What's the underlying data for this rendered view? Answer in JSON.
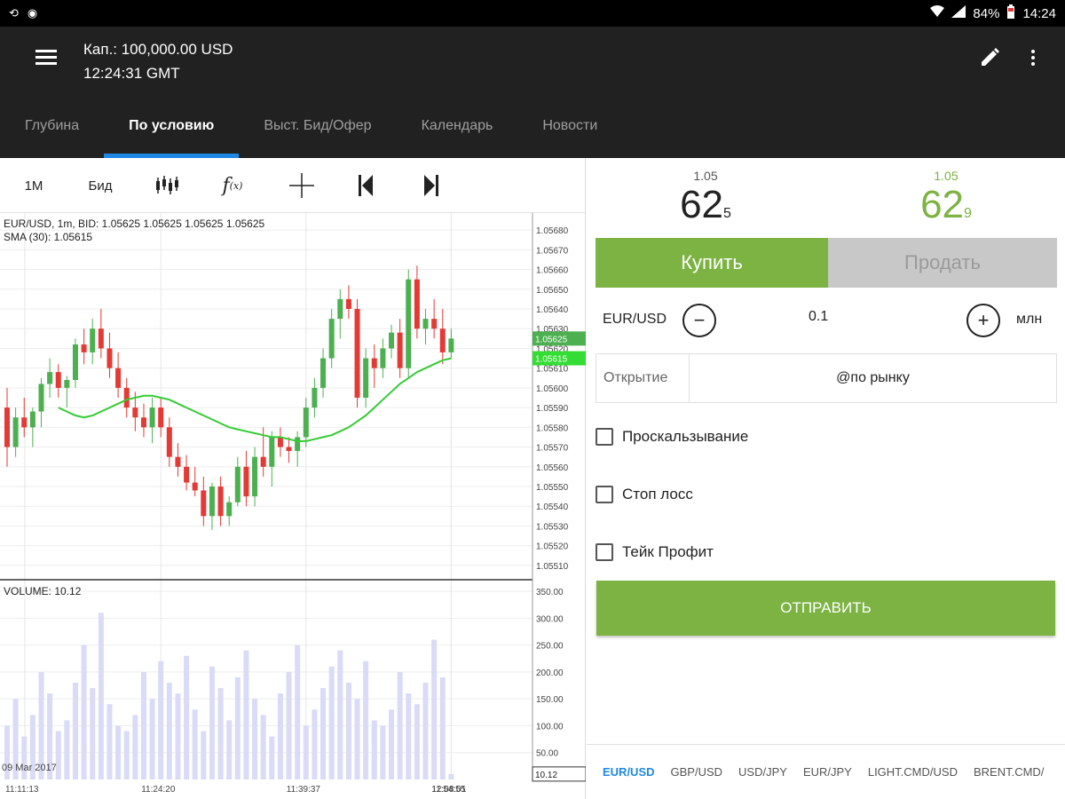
{
  "status_bar": {
    "left_icons": [
      "sync-icon",
      "notification-icon"
    ],
    "battery": "84%",
    "time": "14:24"
  },
  "header": {
    "capital": "Кап.: 100,000.00 USD",
    "time": "12:24:31 GMT"
  },
  "tabs": [
    {
      "label": "Глубина",
      "active": false
    },
    {
      "label": "По условию",
      "active": true
    },
    {
      "label": "Выст. Бид/Офер",
      "active": false
    },
    {
      "label": "Календарь",
      "active": false
    },
    {
      "label": "Новости",
      "active": false
    }
  ],
  "chart_toolbar": {
    "timeframe": "1M",
    "price_type": "Бид",
    "icons": [
      "candlestick-icon",
      "function-icon",
      "crosshair-icon",
      "jump-start-icon",
      "jump-end-icon"
    ]
  },
  "chart_info": {
    "line1": "EUR/USD, 1m, BID: 1.05625 1.05625 1.05625 1.05625",
    "line2": "SMA (30): 1.05615",
    "volume_label": "VOLUME: 10.12",
    "date_label": "09 Mar 2017"
  },
  "chart_data": {
    "type": "candlestick",
    "symbol": "EUR/USD",
    "timeframe": "1m",
    "price_ylim": [
      1.05505,
      1.05685
    ],
    "price_ticks": [
      "1.05680",
      "1.05670",
      "1.05660",
      "1.05650",
      "1.05640",
      "1.05630",
      "1.05620",
      "1.05610",
      "1.05600",
      "1.05590",
      "1.05580",
      "1.05570",
      "1.05560",
      "1.05550",
      "1.05540",
      "1.05530",
      "1.05520",
      "1.05510"
    ],
    "bid_marker": "1.05625",
    "sma_marker": "1.05615",
    "volume_ylim": [
      0,
      360
    ],
    "volume_ticks": [
      "350.00",
      "300.00",
      "250.00",
      "200.00",
      "150.00",
      "100.00",
      "50.00"
    ],
    "volume_current": "10.12",
    "time_labels": [
      "11:11:13",
      "11:24:20",
      "11:39:37",
      "11:54:55",
      "12:08:01"
    ],
    "time_label_index": [
      0,
      18,
      35,
      53,
      71
    ],
    "candles": [
      [
        1.0559,
        1.056,
        1.0556,
        1.0557
      ],
      [
        1.0557,
        1.0559,
        1.05565,
        1.05585
      ],
      [
        1.05585,
        1.05595,
        1.05575,
        1.0558
      ],
      [
        1.0558,
        1.0559,
        1.0557,
        1.05588
      ],
      [
        1.05588,
        1.05605,
        1.0558,
        1.05602
      ],
      [
        1.05602,
        1.05615,
        1.05595,
        1.05608
      ],
      [
        1.05608,
        1.05612,
        1.05595,
        1.056
      ],
      [
        1.056,
        1.05606,
        1.0559,
        1.05604
      ],
      [
        1.05604,
        1.05625,
        1.056,
        1.05622
      ],
      [
        1.05622,
        1.0563,
        1.05612,
        1.05618
      ],
      [
        1.05618,
        1.05635,
        1.05612,
        1.0563
      ],
      [
        1.0563,
        1.0564,
        1.05615,
        1.0562
      ],
      [
        1.0562,
        1.05628,
        1.05605,
        1.0561
      ],
      [
        1.0561,
        1.05618,
        1.05595,
        1.056
      ],
      [
        1.056,
        1.05605,
        1.05585,
        1.0559
      ],
      [
        1.0559,
        1.05598,
        1.05578,
        1.05585
      ],
      [
        1.05585,
        1.05592,
        1.05575,
        1.0558
      ],
      [
        1.0558,
        1.05595,
        1.05572,
        1.0559
      ],
      [
        1.0559,
        1.05595,
        1.05575,
        1.0558
      ],
      [
        1.0558,
        1.05585,
        1.0556,
        1.05565
      ],
      [
        1.05565,
        1.05572,
        1.05555,
        1.0556
      ],
      [
        1.0556,
        1.05566,
        1.05548,
        1.05552
      ],
      [
        1.05552,
        1.0556,
        1.05545,
        1.05548
      ],
      [
        1.05548,
        1.05555,
        1.0553,
        1.05535
      ],
      [
        1.05535,
        1.05552,
        1.05528,
        1.0555
      ],
      [
        1.0555,
        1.05555,
        1.0553,
        1.05535
      ],
      [
        1.05535,
        1.05545,
        1.0553,
        1.05542
      ],
      [
        1.05542,
        1.05565,
        1.0554,
        1.0556
      ],
      [
        1.0556,
        1.05568,
        1.0554,
        1.05545
      ],
      [
        1.05545,
        1.0557,
        1.0554,
        1.05565
      ],
      [
        1.05565,
        1.0558,
        1.05555,
        1.0556
      ],
      [
        1.0556,
        1.05578,
        1.0555,
        1.05575
      ],
      [
        1.05575,
        1.0558,
        1.05565,
        1.0557
      ],
      [
        1.0557,
        1.05575,
        1.05562,
        1.05568
      ],
      [
        1.05568,
        1.05578,
        1.0556,
        1.05575
      ],
      [
        1.05575,
        1.05595,
        1.0557,
        1.0559
      ],
      [
        1.0559,
        1.05605,
        1.05585,
        1.056
      ],
      [
        1.056,
        1.0562,
        1.05595,
        1.05615
      ],
      [
        1.05615,
        1.0564,
        1.0561,
        1.05635
      ],
      [
        1.05635,
        1.0565,
        1.05625,
        1.05645
      ],
      [
        1.05645,
        1.05652,
        1.05635,
        1.0564
      ],
      [
        1.0564,
        1.05645,
        1.0559,
        1.05595
      ],
      [
        1.05595,
        1.0562,
        1.0559,
        1.05615
      ],
      [
        1.05615,
        1.05622,
        1.056,
        1.0561
      ],
      [
        1.0561,
        1.05625,
        1.05605,
        1.0562
      ],
      [
        1.0562,
        1.05632,
        1.05615,
        1.05628
      ],
      [
        1.05628,
        1.05635,
        1.05605,
        1.0561
      ],
      [
        1.0561,
        1.0566,
        1.05605,
        1.05655
      ],
      [
        1.05655,
        1.05662,
        1.05625,
        1.0563
      ],
      [
        1.0563,
        1.0564,
        1.05622,
        1.05635
      ],
      [
        1.05635,
        1.05645,
        1.05625,
        1.0563
      ],
      [
        1.0563,
        1.0564,
        1.05612,
        1.05618
      ],
      [
        1.05618,
        1.0563,
        1.05615,
        1.05625
      ]
    ],
    "sma": [
      1.0559,
      1.05588,
      1.05586,
      1.05585,
      1.05586,
      1.05588,
      1.0559,
      1.05592,
      1.05594,
      1.05595,
      1.05596,
      1.05596,
      1.05595,
      1.05594,
      1.05592,
      1.0559,
      1.05588,
      1.05586,
      1.05584,
      1.05582,
      1.0558,
      1.05579,
      1.05578,
      1.05577,
      1.05576,
      1.05575,
      1.05575,
      1.05574,
      1.05573,
      1.05573,
      1.05574,
      1.05575,
      1.05576,
      1.05578,
      1.0558,
      1.05583,
      1.05586,
      1.0559,
      1.05594,
      1.05598,
      1.05602,
      1.05605,
      1.05608,
      1.0561,
      1.05612,
      1.05614,
      1.05615
    ],
    "volumes": [
      100,
      150,
      80,
      120,
      200,
      160,
      90,
      110,
      180,
      250,
      170,
      310,
      140,
      100,
      90,
      120,
      200,
      150,
      220,
      180,
      160,
      230,
      130,
      90,
      210,
      170,
      110,
      190,
      240,
      150,
      120,
      80,
      160,
      200,
      250,
      100,
      130,
      170,
      210,
      240,
      180,
      150,
      220,
      110,
      100,
      130,
      200,
      160,
      140,
      180,
      260,
      190,
      10
    ]
  },
  "quotes": {
    "bid_prefix": "1.05",
    "bid_main": "62",
    "bid_pip": "5",
    "ask_prefix": "1.05",
    "ask_main": "62",
    "ask_pip": "9",
    "ask_color": "#7cb342"
  },
  "order": {
    "buy_label": "Купить",
    "sell_label": "Продать",
    "symbol": "EUR/USD",
    "quantity": "0.1",
    "units": "млн",
    "opening_label": "Открытие",
    "opening_value": "@по рынку",
    "slippage_label": "Проскальзывание",
    "stop_loss_label": "Стоп лосс",
    "take_profit_label": "Тейк Профит",
    "submit_label": "ОТПРАВИТЬ"
  },
  "pairs": [
    {
      "label": "EUR/USD",
      "active": true
    },
    {
      "label": "GBP/USD",
      "active": false
    },
    {
      "label": "USD/JPY",
      "active": false
    },
    {
      "label": "EUR/JPY",
      "active": false
    },
    {
      "label": "LIGHT.CMD/USD",
      "active": false
    },
    {
      "label": "BRENT.CMD/",
      "active": false
    }
  ],
  "colors": {
    "accent_green": "#7cb342",
    "tab_indicator": "#1e88e5",
    "candle_up": "#4caf50",
    "candle_down": "#e53935",
    "sma_line": "#33cc33"
  }
}
